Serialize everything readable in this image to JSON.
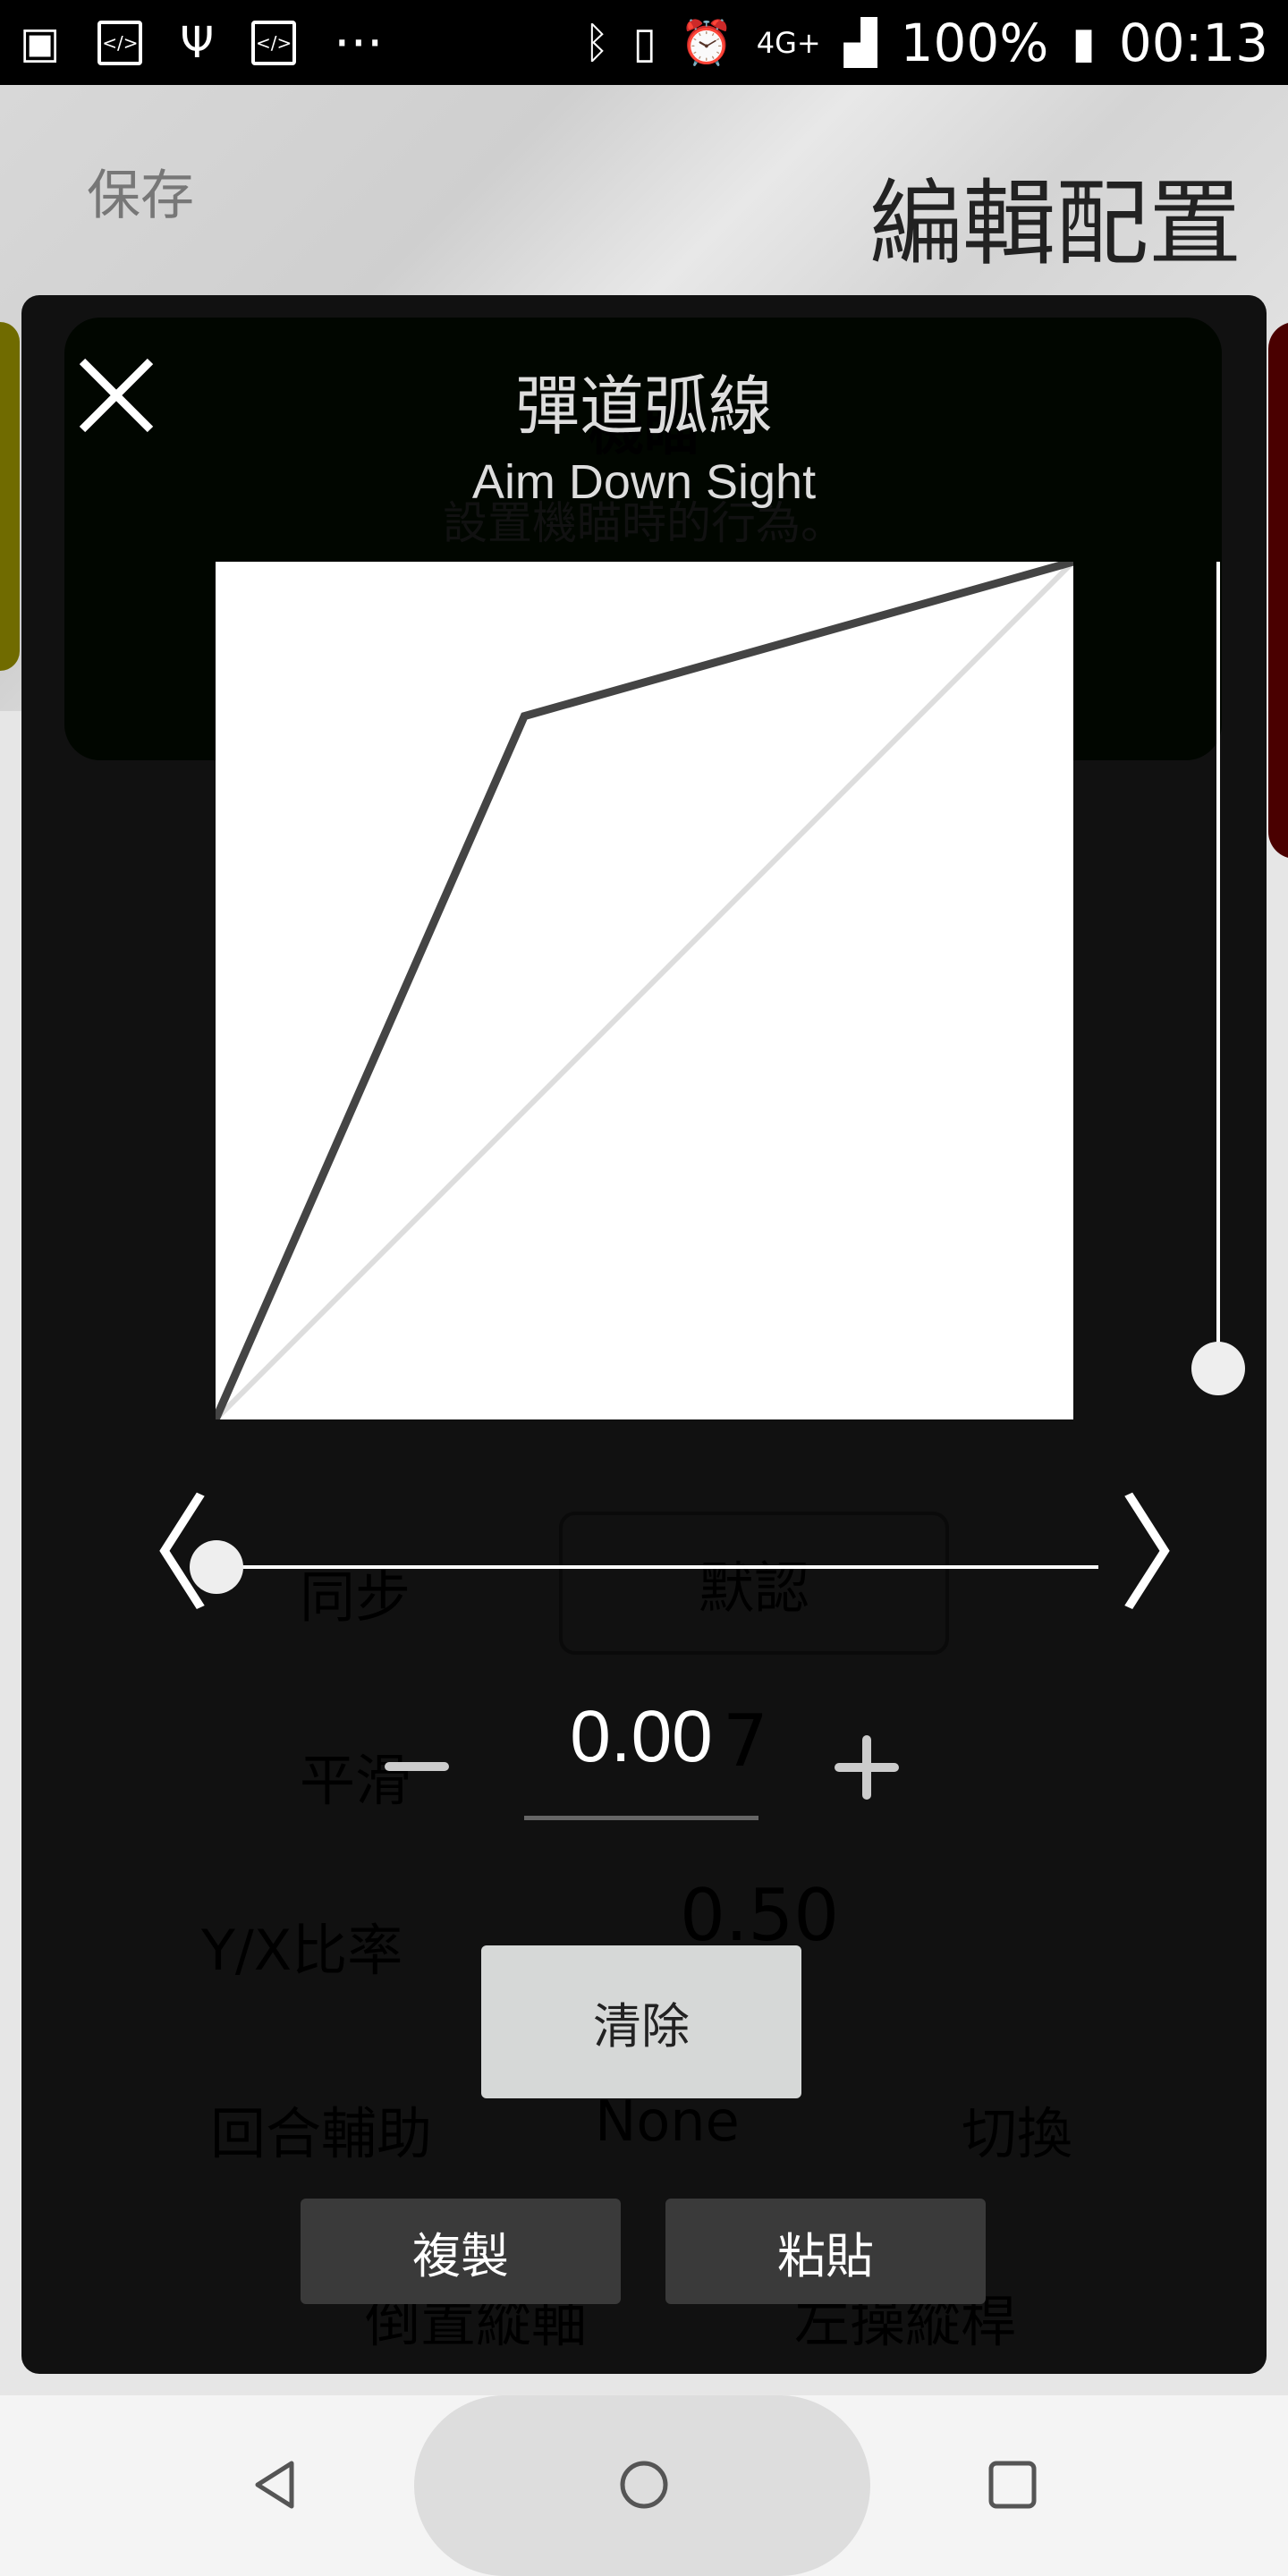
{
  "status_bar": {
    "left_icons": [
      "image-icon",
      "code-icon",
      "usb-icon",
      "code-icon",
      "more-icon"
    ],
    "more": "···",
    "right_icons": [
      "bluetooth-icon",
      "vibrate-icon",
      "alarm-icon",
      "4g-plus-icon",
      "signal-icon"
    ],
    "network": "4G+",
    "battery": "100%",
    "time": "00:13"
  },
  "header": {
    "save": "保存",
    "title": "編輯配置"
  },
  "background": {
    "card_title": "機瞄",
    "card_desc": "設置機瞄時的行為。",
    "sync_label": "同步",
    "sync_value": "默認",
    "smooth_label": "平滑",
    "smooth_value": "7",
    "ratio_label": "Y/X比率",
    "ratio_value": "0.50",
    "round_assist": "回合輔助",
    "round_assist_value": "None",
    "toggle": "切換",
    "invert": "倒置縱軸",
    "left_stick": "左操縱桿"
  },
  "dialog": {
    "title": "彈道弧線",
    "subtitle": "Aim Down Sight",
    "value": "0.00",
    "clear": "清除",
    "copy": "複製",
    "paste": "粘貼",
    "prev": "〈",
    "next": "〉",
    "h_slider": 0,
    "v_slider": 0.03
  },
  "chart_data": {
    "type": "line",
    "xlim": [
      0,
      1
    ],
    "ylim": [
      0,
      1
    ],
    "series": [
      {
        "x": [
          0,
          0.36,
          1
        ],
        "y": [
          0,
          0.82,
          1
        ],
        "color": "#444444"
      },
      {
        "x": [
          0,
          1
        ],
        "y": [
          0,
          1
        ],
        "color": "#dddddd"
      }
    ]
  },
  "nav": {
    "icons": [
      "back-icon",
      "home-icon",
      "recents-icon"
    ]
  }
}
